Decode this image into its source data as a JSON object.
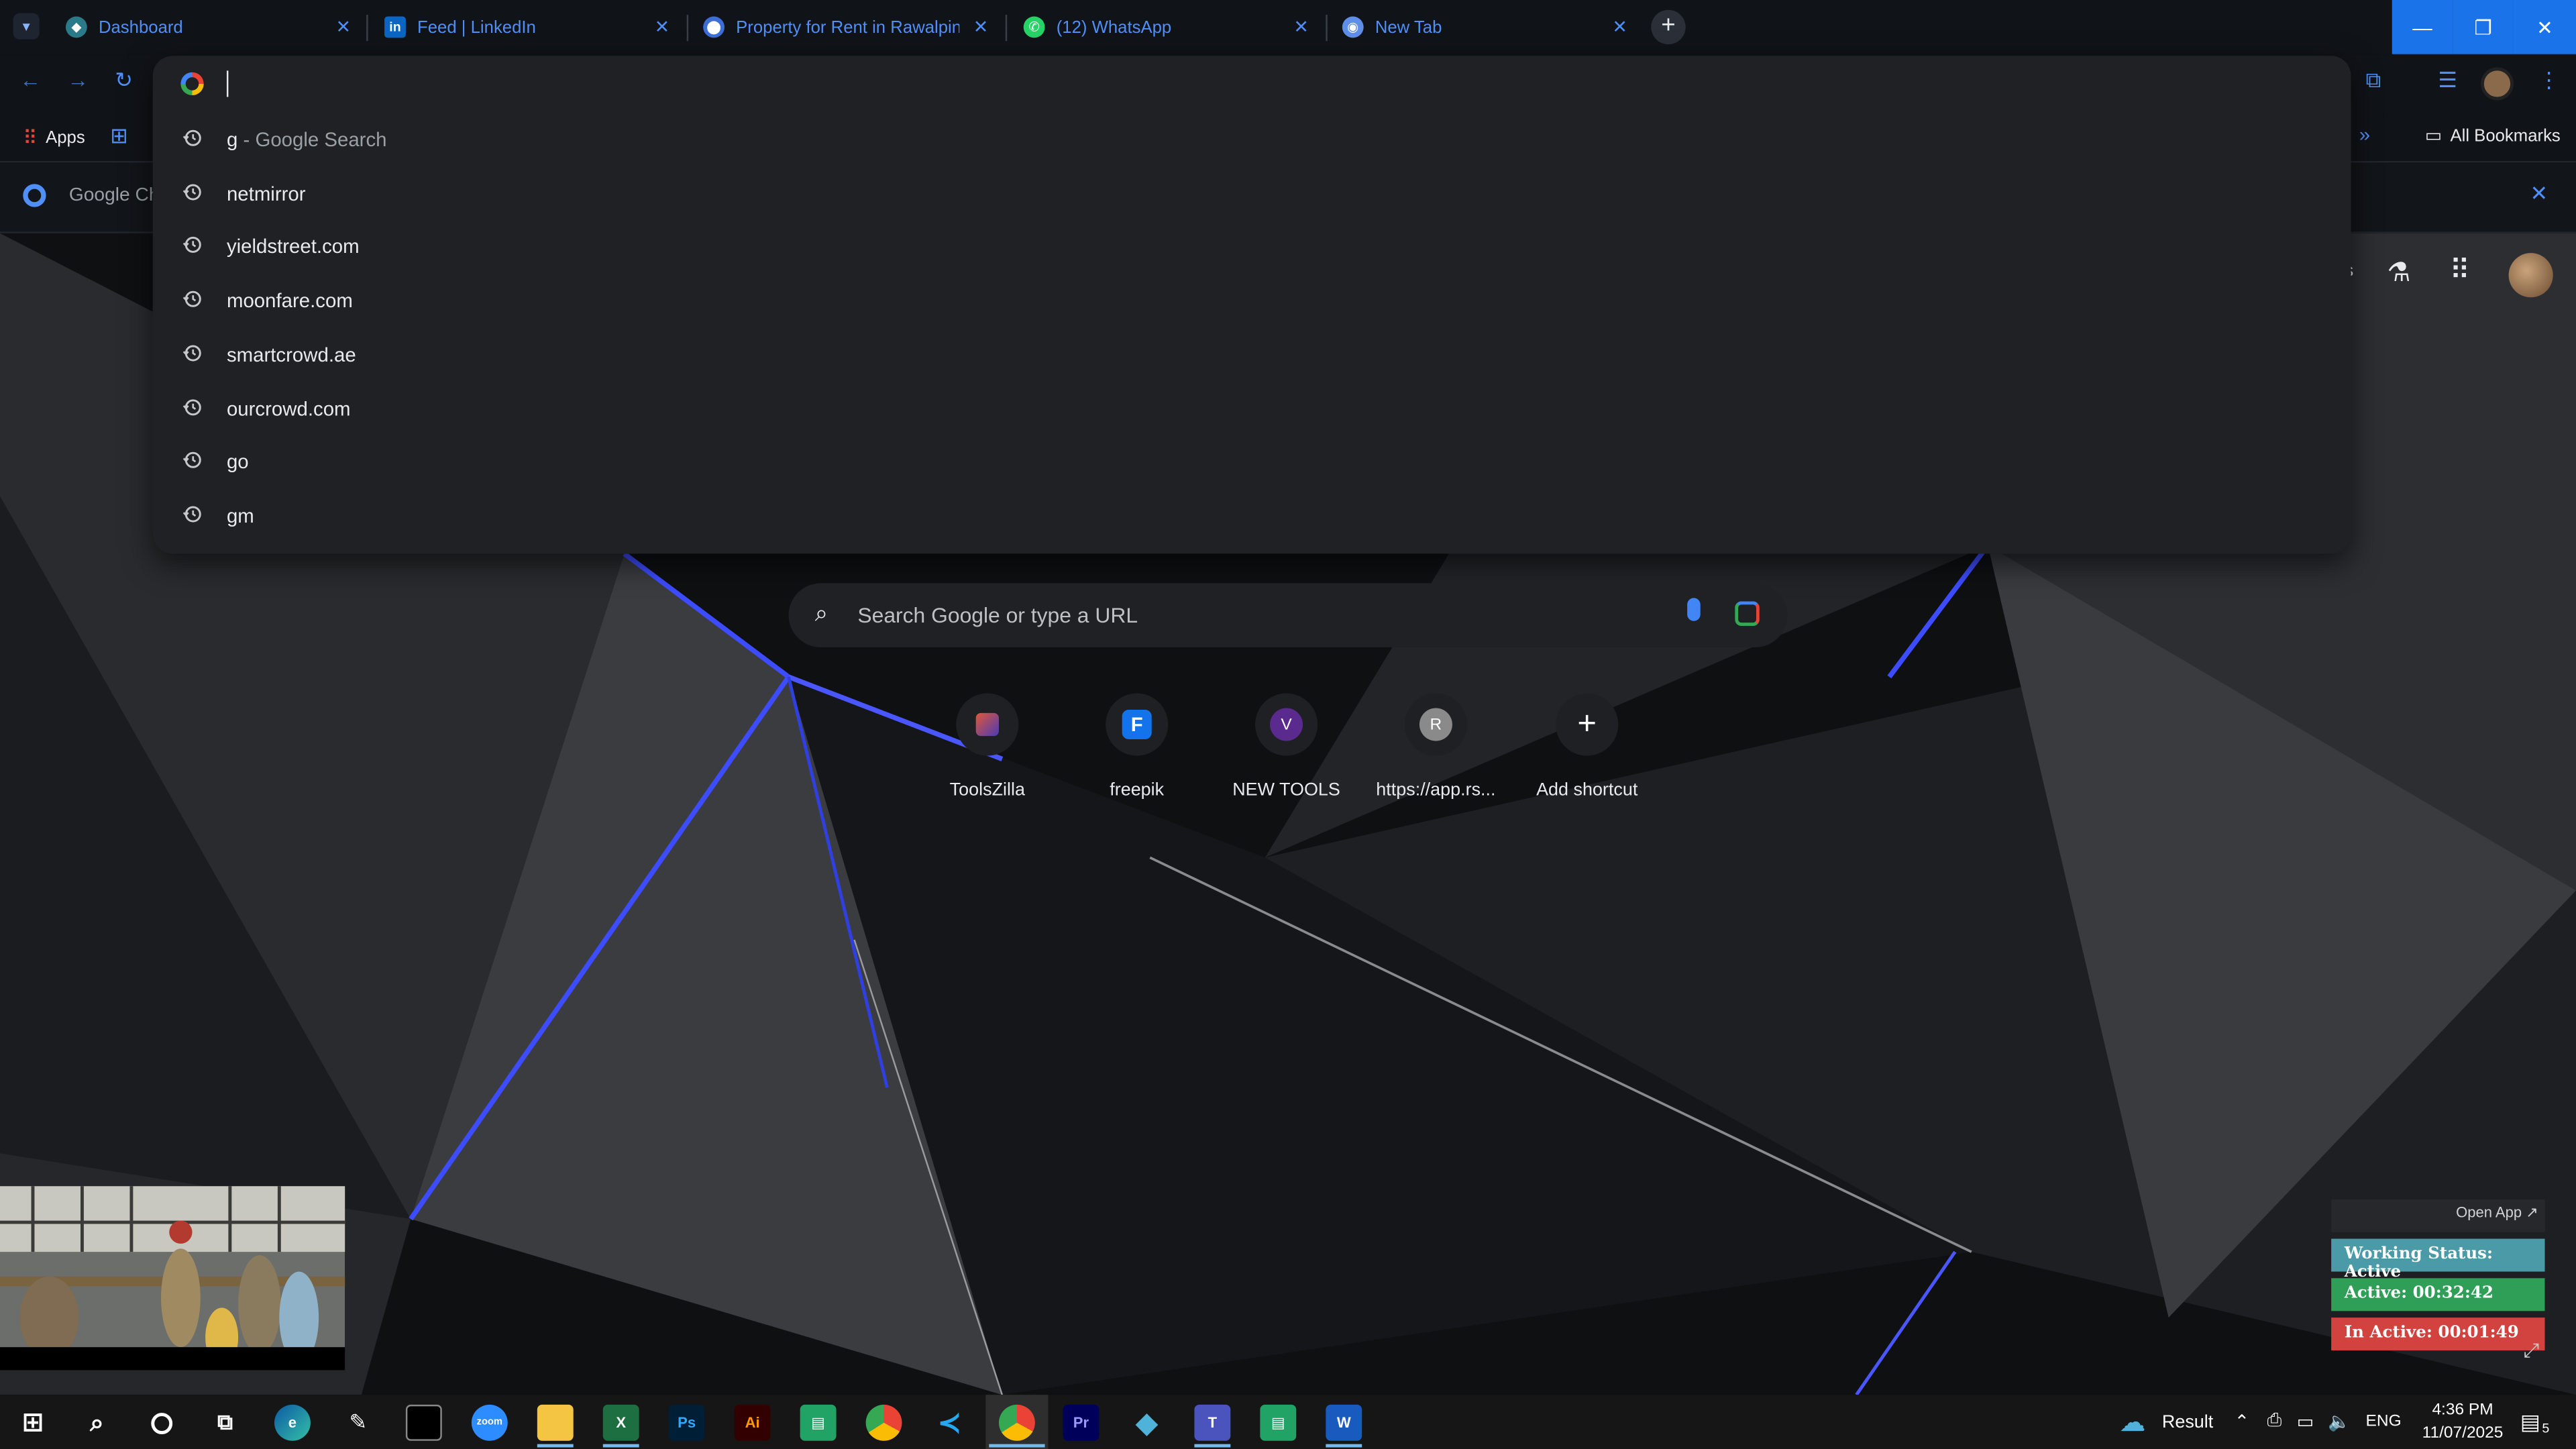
{
  "browser": {
    "tabs": [
      {
        "label": "Dashboard",
        "favicon": "dashboard-favicon-icon"
      },
      {
        "label": "Feed | LinkedIn",
        "favicon": "linkedin-favicon-icon"
      },
      {
        "label": "Property for Rent in Rawalpindi",
        "favicon": "property-favicon-icon"
      },
      {
        "label": "(12) WhatsApp",
        "favicon": "whatsapp-favicon-icon"
      },
      {
        "label": "New Tab",
        "favicon": "chrome-favicon-icon"
      }
    ],
    "bookmarks": {
      "apps_label": "Apps",
      "all_label": "All Bookmarks"
    },
    "infobar_text": "Google Ch"
  },
  "omnibox": {
    "value": "",
    "suggestions": [
      {
        "text": "g",
        "sub": " - Google Search"
      },
      {
        "text": "netmirror",
        "sub": ""
      },
      {
        "text": "yieldstreet.com",
        "sub": ""
      },
      {
        "text": "moonfare.com",
        "sub": ""
      },
      {
        "text": "smartcrowd.ae",
        "sub": ""
      },
      {
        "text": "ourcrowd.com",
        "sub": ""
      },
      {
        "text": "go",
        "sub": ""
      },
      {
        "text": "gm",
        "sub": ""
      }
    ]
  },
  "ntp": {
    "header_fragment": "s",
    "search_placeholder": "Search Google or type a URL",
    "shortcuts": [
      {
        "label": "ToolsZilla",
        "glyph": ""
      },
      {
        "label": "freepik",
        "glyph": ""
      },
      {
        "label": "NEW TOOLS",
        "glyph": "V"
      },
      {
        "label": "https://app.rs...",
        "glyph": "R"
      },
      {
        "label": "Add shortcut",
        "glyph": "+"
      }
    ]
  },
  "status_widget": {
    "open_app": "Open App ↗",
    "working": "Working Status: Active",
    "active": "Active: 00:32:42",
    "inactive": "In Active: 00:01:49",
    "colors": {
      "working": "#4a9aa8",
      "active": "#2f9e56",
      "inactive": "#d2433f"
    }
  },
  "taskbar": {
    "icons": [
      "windows-start-icon",
      "search-icon",
      "cortana-icon",
      "task-view-icon",
      "edge-icon",
      "pen-icon",
      "terminal-icon",
      "zoom-icon",
      "file-explorer-icon",
      "excel-icon",
      "photoshop-icon",
      "illustrator-icon",
      "sheets-app-icon",
      "chrome-icon",
      "vscode-icon",
      "chrome-active-icon",
      "premiere-icon",
      "app-diamond-icon",
      "teams-icon",
      "sheets-app-2-icon",
      "word-icon"
    ],
    "zoom_text": "zoom",
    "ps_text": "Ps",
    "ai_text": "Ai",
    "pr_text": "Pr",
    "weather_text": "Result",
    "lang": "ENG",
    "time": "4:36 PM",
    "date": "11/07/2025",
    "notif_count": "5"
  }
}
